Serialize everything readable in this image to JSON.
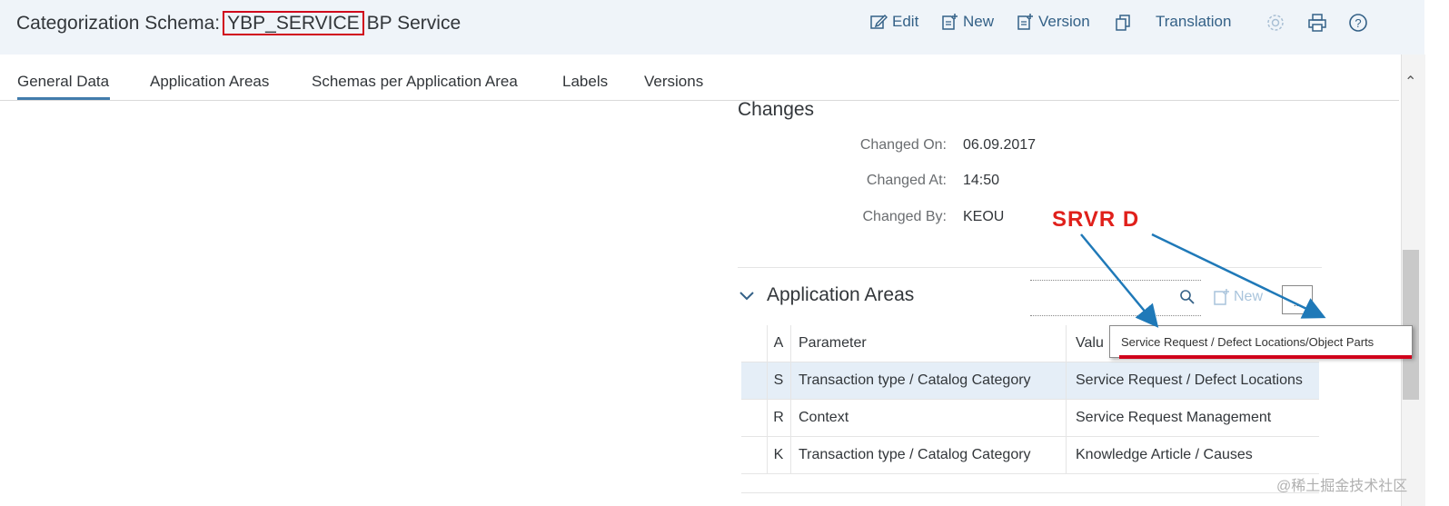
{
  "header": {
    "title_prefix": "Categorization Schema:",
    "schema_id": "YBP_SERVICE",
    "schema_name": "BP Service",
    "actions": {
      "edit": "Edit",
      "new": "New",
      "version": "Version",
      "translation": "Translation"
    },
    "icons": [
      "settings-icon",
      "print-icon",
      "help-icon",
      "copy-icon"
    ]
  },
  "tabs": [
    "General Data",
    "Application Areas",
    "Schemas per Application Area",
    "Labels",
    "Versions"
  ],
  "active_tab": "General Data",
  "changes": {
    "title": "Changes",
    "fields": [
      {
        "label": "Changed On:",
        "value": "06.09.2017"
      },
      {
        "label": "Changed At:",
        "value": "14:50"
      },
      {
        "label": "Changed By:",
        "value": "KEOU"
      }
    ]
  },
  "annotation": "SRVR D",
  "app_areas": {
    "title": "Application Areas",
    "search_placeholder": "",
    "new_label": "New",
    "more_label": "...",
    "columns": [
      "A",
      "Parameter",
      "Valu"
    ],
    "rows": [
      {
        "a": "S",
        "parameter": "Transaction type / Catalog Category",
        "value": "Service Request / Defect Locations",
        "selected": true
      },
      {
        "a": "R",
        "parameter": "Context",
        "value": "Service Request Management",
        "selected": false
      },
      {
        "a": "K",
        "parameter": "Transaction type / Catalog Category",
        "value": "Knowledge Article / Causes",
        "selected": false
      }
    ]
  },
  "tooltip": "Service Request / Defect Locations/Object Parts",
  "watermark": "@稀土掘金技术社区",
  "colors": {
    "accent": "#427cac",
    "link": "#346187",
    "highlight": "#d0021b",
    "selected_row": "#e5eef7",
    "header_bg": "#eff4f9"
  }
}
